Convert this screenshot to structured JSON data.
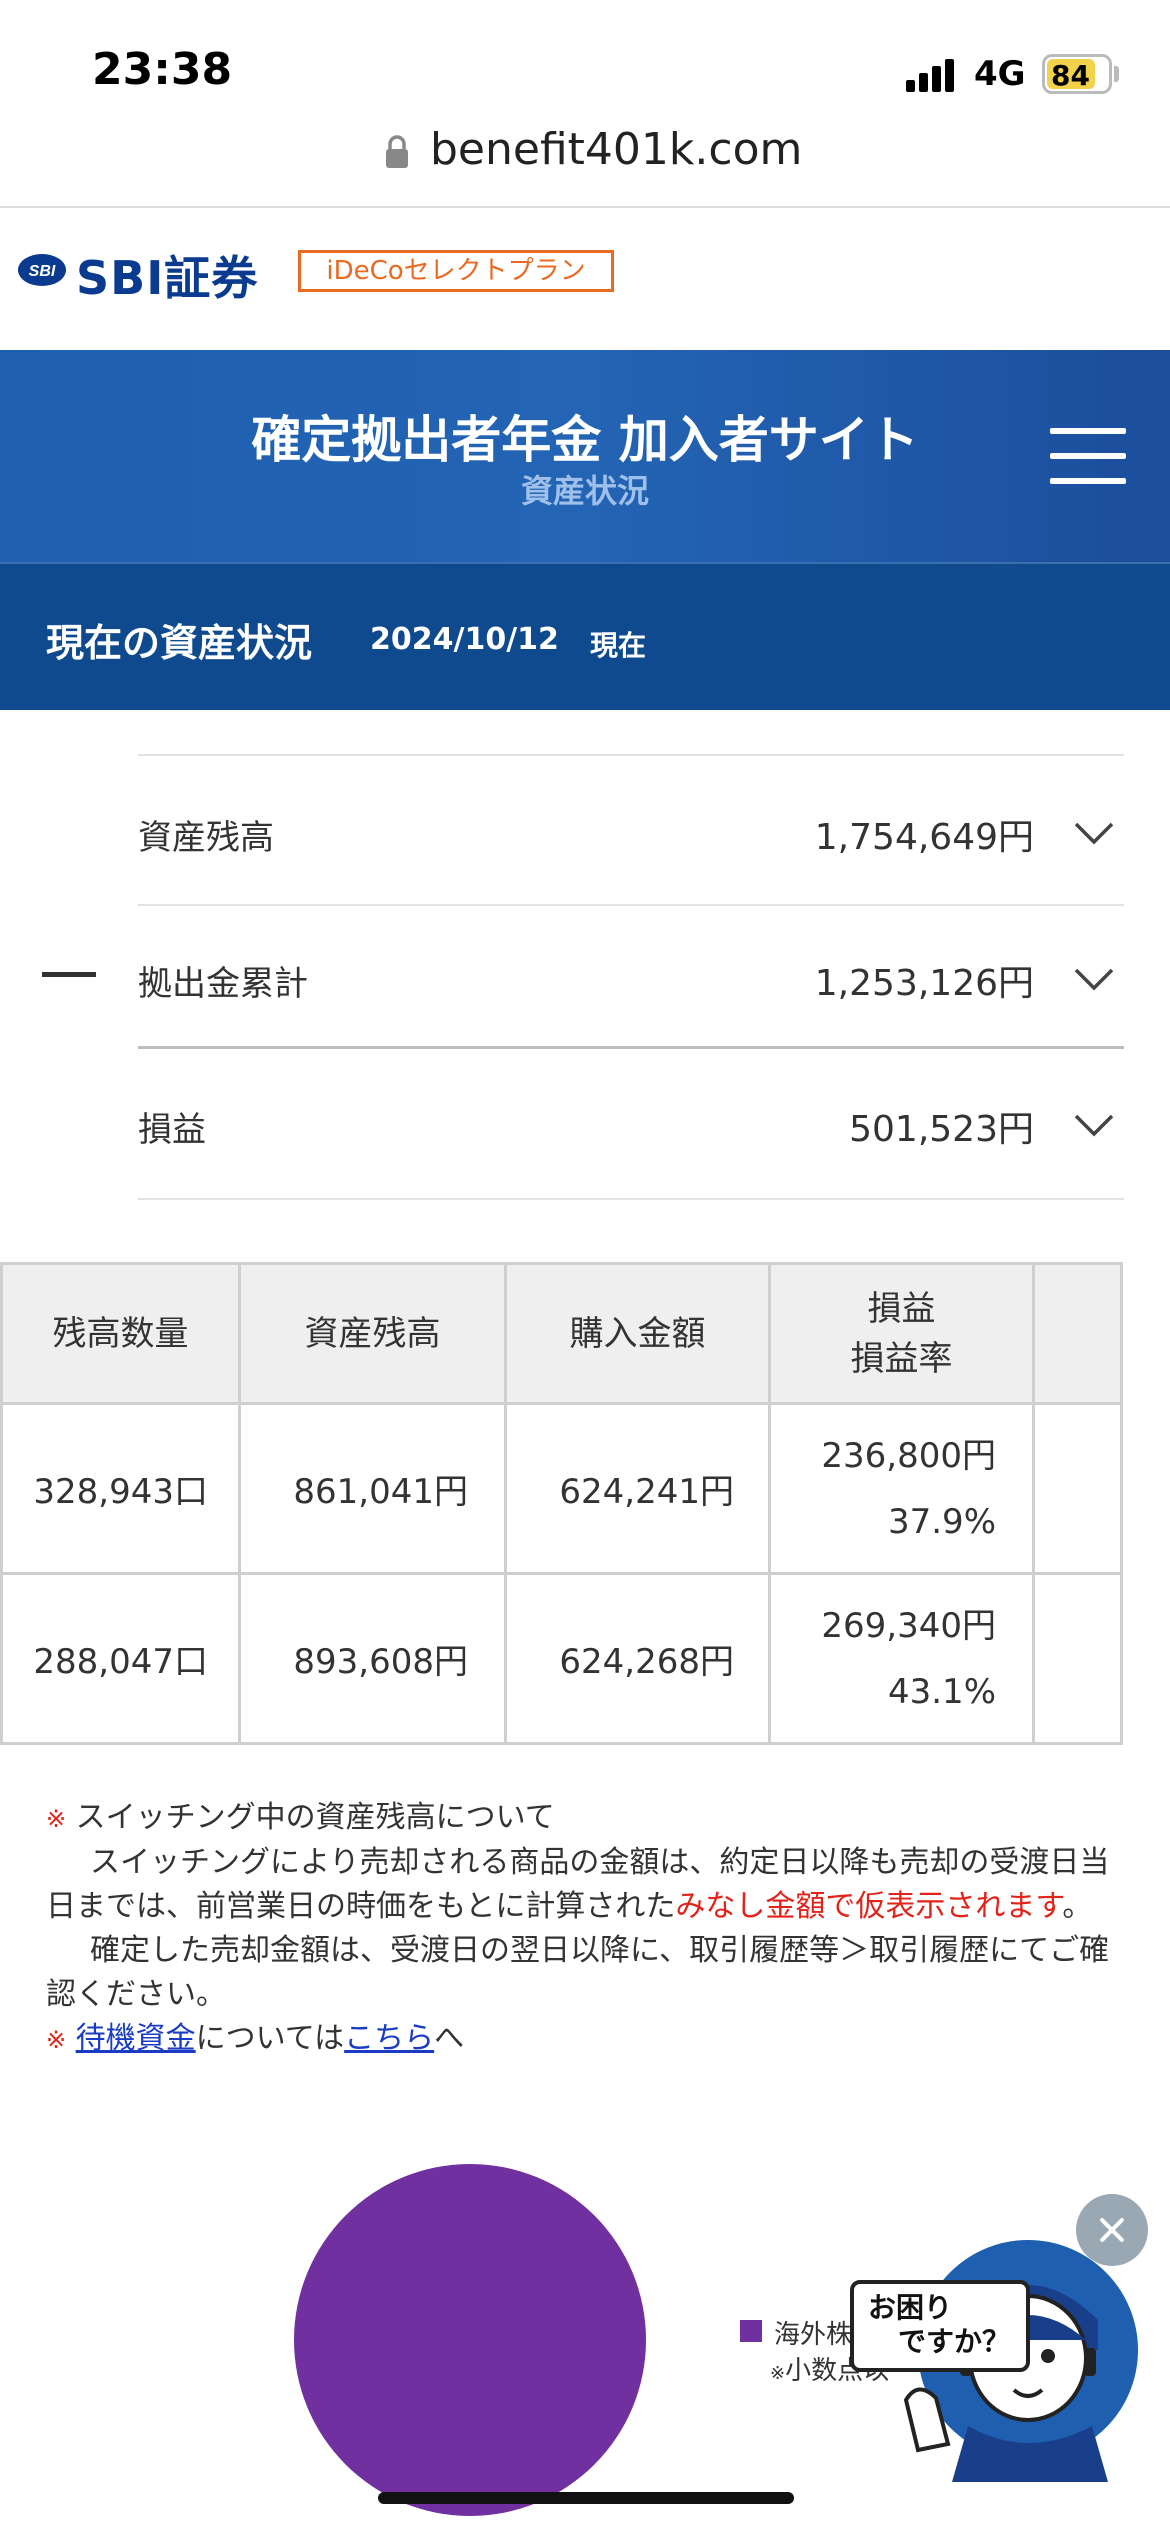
{
  "status_bar": {
    "time": "23:38",
    "network": "4G",
    "battery": "84"
  },
  "browser": {
    "url": "benefit401k.com"
  },
  "logo": {
    "mark": "SBI",
    "brand": "SBI証券",
    "badge": "iDeCoセレクトプラン"
  },
  "header": {
    "title": "確定拠出者年金 加入者サイト",
    "subtitle": "資産状況"
  },
  "section": {
    "title": "現在の資産状況",
    "date": "2024/10/12",
    "suffix": "現在"
  },
  "summary": [
    {
      "label": "資産残高",
      "value": "1,754,649円"
    },
    {
      "label": "拠出金累計",
      "value": "1,253,126円"
    },
    {
      "label": "損益",
      "value": "501,523円"
    }
  ],
  "table": {
    "headers": [
      "残高数量",
      "資産残高",
      "購入金額",
      "損益",
      "損益率",
      ""
    ],
    "rows": [
      {
        "qty": "328,943口",
        "balance": "861,041円",
        "purchase": "624,241円",
        "gain": "236,800円",
        "rate": "37.9%"
      },
      {
        "qty": "288,047口",
        "balance": "893,608円",
        "purchase": "624,268円",
        "gain": "269,340円",
        "rate": "43.1%"
      }
    ]
  },
  "notes": {
    "mark": "※",
    "heading": "スイッチング中の資産残高について",
    "para1_a": "スイッチングにより売却される商品の金額は、約定日以降も売却の受渡日当日までは、前営業日の時価をもとに計算された",
    "para1_red": "みなし金額で仮表示されます",
    "para1_end": "。",
    "para2": "確定した売却金額は、受渡日の翌日以降に、取引履歴等＞取引履歴にてご確認ください。",
    "link1": "待機資金",
    "mid": "については",
    "link2": "こちら",
    "end": "へ"
  },
  "pie": {
    "legend_label": "海外株式",
    "legend_note_mark": "※",
    "legend_note": "小数点以",
    "color": "#7030a0"
  },
  "helper": {
    "line1": "お困り",
    "line2": "ですか？"
  }
}
